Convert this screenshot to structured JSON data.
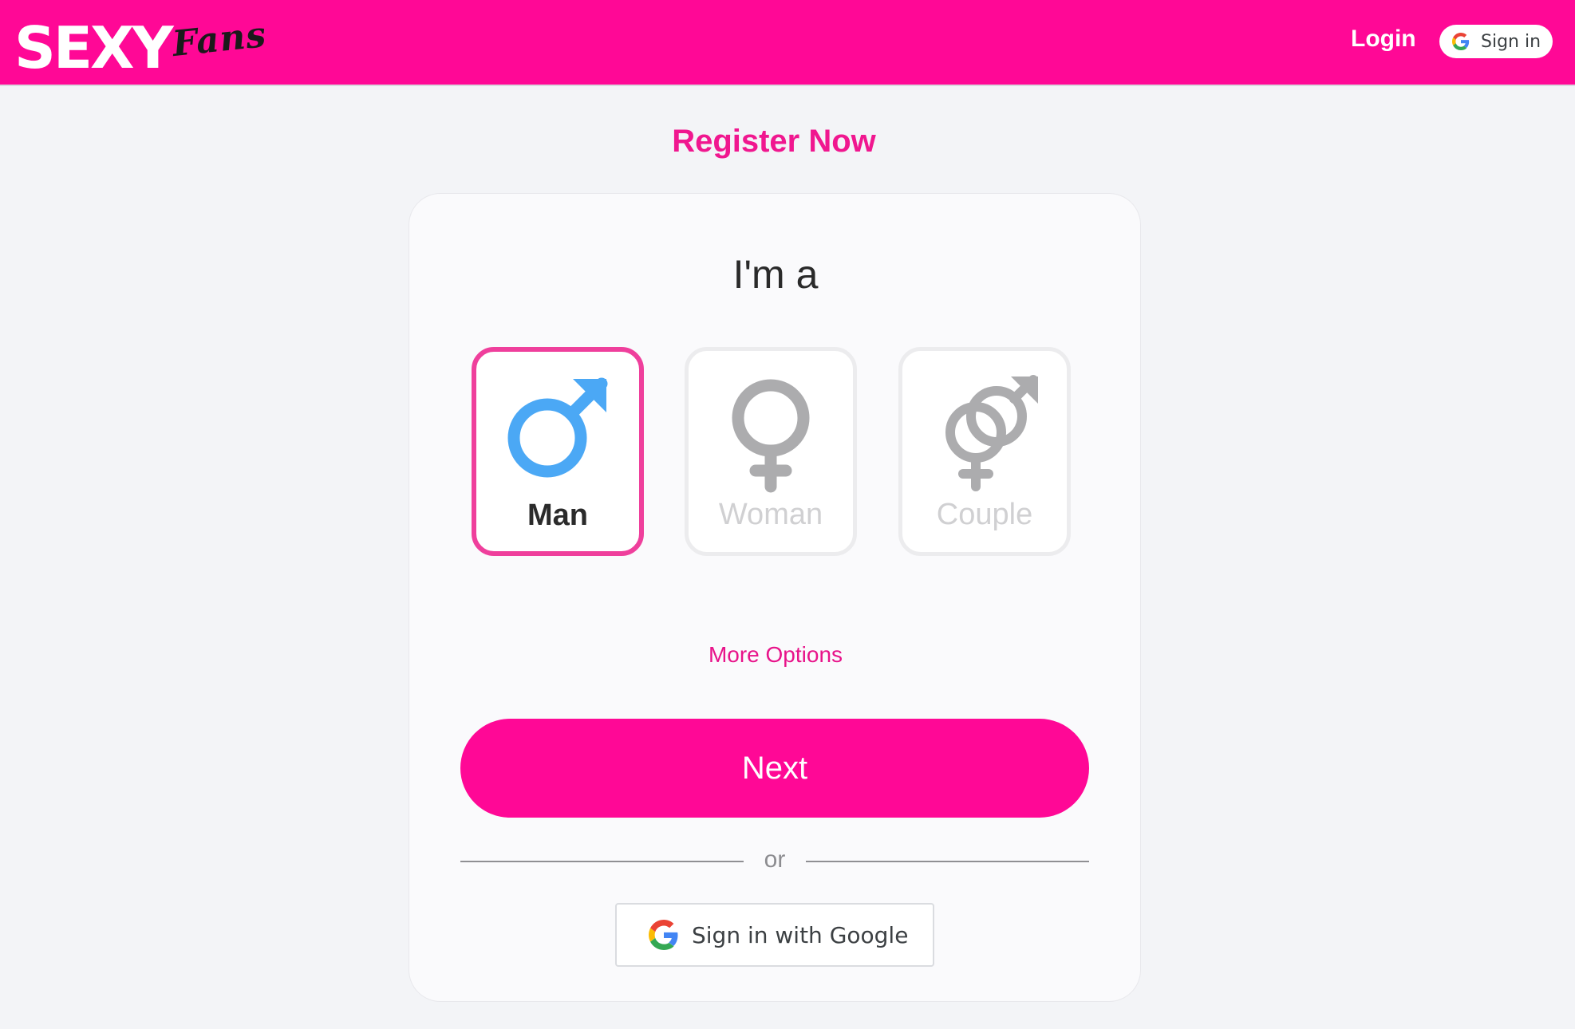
{
  "header": {
    "logo_main": "SEXY",
    "logo_script": "Fans",
    "login_label": "Login",
    "signin_label": "Sign in",
    "background_color": "#ff0896"
  },
  "page": {
    "title": "Register Now"
  },
  "card": {
    "heading": "I'm a",
    "options": [
      {
        "label": "Man",
        "icon": "male-icon",
        "selected": true,
        "icon_color": "#4ba8f5"
      },
      {
        "label": "Woman",
        "icon": "female-icon",
        "selected": false,
        "icon_color": "#acacae"
      },
      {
        "label": "Couple",
        "icon": "couple-icon",
        "selected": false,
        "icon_color": "#acacae"
      }
    ],
    "more_options_label": "More Options",
    "next_label": "Next",
    "divider_text": "or",
    "google_signin_label": "Sign in with Google"
  },
  "colors": {
    "accent": "#ff0896",
    "selected_border": "#ef3f9c"
  }
}
